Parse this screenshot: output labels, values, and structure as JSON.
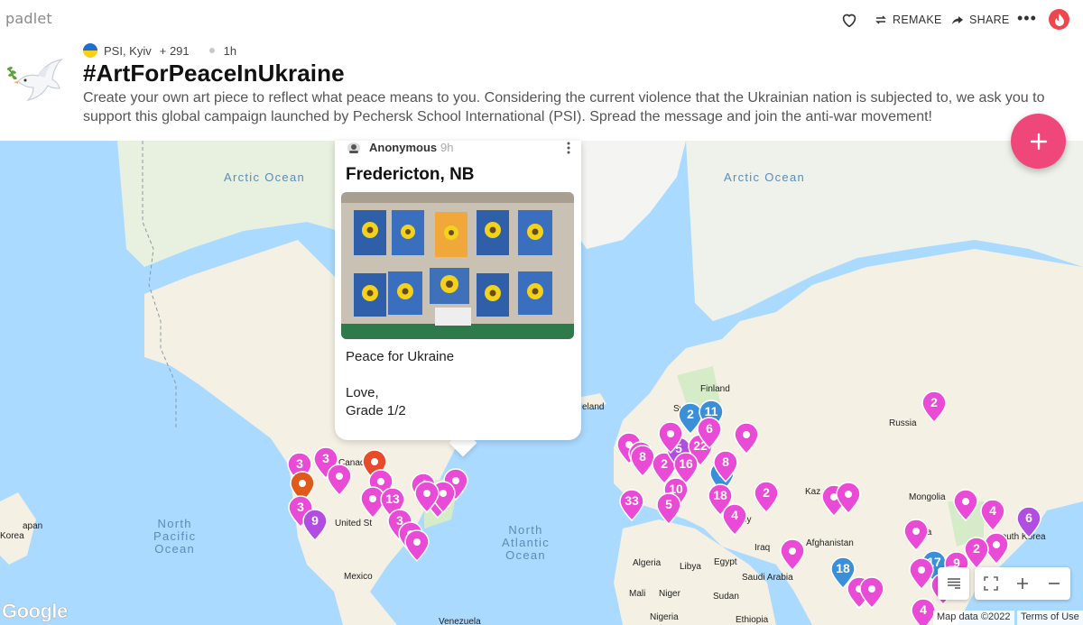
{
  "app": {
    "logo": "padlet"
  },
  "toolbar": {
    "remake_label": "REMAKE",
    "share_label": "SHARE",
    "more_label": "•••"
  },
  "header": {
    "author": "PSI, Kyiv",
    "plus_count": "+ 291",
    "age": "1h",
    "title": "#ArtForPeaceInUkraine",
    "description": "Create your own art piece to reflect what peace means to you. Considering the current violence that the Ukrainian nation is subjected to, we ask you to support this global campaign launched by Pechersk School International (PSI). Spread the message and join the anti-war movement!"
  },
  "post": {
    "author": "Anonymous",
    "time": "9h",
    "title": "Fredericton, NB",
    "body": "Peace for Ukraine\n\nLove,\nGrade 1/2"
  },
  "map": {
    "oceans": [
      {
        "id": "arctic-west",
        "text": "Arctic Ocean"
      },
      {
        "id": "arctic-east",
        "text": "Arctic Ocean"
      },
      {
        "id": "north-pacific",
        "text": "North\nPacific\nOcean"
      },
      {
        "id": "north-atlantic",
        "text": "North\nAtlantic\nOcean"
      }
    ],
    "places": [
      "Finland",
      "Sw",
      "eland",
      "Russia",
      "Canad",
      "United St",
      "Mexico",
      "Kaz",
      "Mongolia",
      "Afghanistan",
      "Iraq",
      "Saudi Arabia",
      "Egypt",
      "Libya",
      "Algeria",
      "Mali",
      "Niger",
      "Nigeria",
      "Sudan",
      "Ethiopia",
      "Venezuela",
      "South Korea",
      "ina",
      "apan",
      "Korea",
      "T",
      "ey"
    ],
    "pins": [
      {
        "label": "3",
        "color": "#e94bd6"
      },
      {
        "label": "3",
        "color": "#e94bd6"
      },
      {
        "label": "",
        "color": "#e94bd6"
      },
      {
        "label": "",
        "color": "#e84a2a"
      },
      {
        "label": "",
        "color": "#e05a1a"
      },
      {
        "label": "3",
        "color": "#e94bd6"
      },
      {
        "label": "9",
        "color": "#b14de0"
      },
      {
        "label": "",
        "color": "#e94bd6"
      },
      {
        "label": "",
        "color": "#e94bd6"
      },
      {
        "label": "13",
        "color": "#e94bd6"
      },
      {
        "label": "4",
        "color": "#e94bd6"
      },
      {
        "label": "5",
        "color": "#e94bd6"
      },
      {
        "label": "3",
        "color": "#e94bd6"
      },
      {
        "label": "",
        "color": "#e94bd6"
      },
      {
        "label": "",
        "color": "#e94bd6"
      },
      {
        "label": "",
        "color": "#e94bd6"
      },
      {
        "label": "",
        "color": "#e94bd6"
      },
      {
        "label": "",
        "color": "#e94bd6"
      },
      {
        "label": "",
        "color": "#e94bd6"
      },
      {
        "label": "",
        "color": "#e94bd6"
      },
      {
        "label": "33",
        "color": "#e94bd6"
      },
      {
        "label": "8",
        "color": "#e94bd6"
      },
      {
        "label": "2",
        "color": "#e94bd6"
      },
      {
        "label": "5",
        "color": "#b14de0"
      },
      {
        "label": "22",
        "color": "#e94bd6"
      },
      {
        "label": "16",
        "color": "#e94bd6"
      },
      {
        "label": "2",
        "color": "#3a8fd8"
      },
      {
        "label": "11",
        "color": "#3a8fd8"
      },
      {
        "label": "6",
        "color": "#e94bd6"
      },
      {
        "label": "",
        "color": "#e94bd6"
      },
      {
        "label": "3",
        "color": "#3a8fd8"
      },
      {
        "label": "8",
        "color": "#e94bd6"
      },
      {
        "label": "10",
        "color": "#e94bd6"
      },
      {
        "label": "18",
        "color": "#e94bd6"
      },
      {
        "label": "5",
        "color": "#e94bd6"
      },
      {
        "label": "4",
        "color": "#e94bd6"
      },
      {
        "label": "2",
        "color": "#e94bd6"
      },
      {
        "label": "",
        "color": "#e94bd6"
      },
      {
        "label": "2",
        "color": "#e94bd6"
      },
      {
        "label": "",
        "color": "#e94bd6"
      },
      {
        "label": "",
        "color": "#e94bd6"
      },
      {
        "label": "",
        "color": "#e94bd6"
      },
      {
        "label": "4",
        "color": "#e94bd6"
      },
      {
        "label": "6",
        "color": "#b14de0"
      },
      {
        "label": "",
        "color": "#e94bd6"
      },
      {
        "label": "",
        "color": "#e94bd6"
      },
      {
        "label": "17",
        "color": "#3a8fd8"
      },
      {
        "label": "9",
        "color": "#e94bd6"
      },
      {
        "label": "2",
        "color": "#e94bd6"
      },
      {
        "label": "",
        "color": "#e94bd6"
      },
      {
        "label": "18",
        "color": "#3a8fd8"
      },
      {
        "label": "",
        "color": "#e94bd6"
      },
      {
        "label": "",
        "color": "#e94bd6"
      },
      {
        "label": "",
        "color": "#e94bd6"
      },
      {
        "label": "4",
        "color": "#e94bd6"
      },
      {
        "label": "",
        "color": "#e94bd6"
      },
      {
        "label": "",
        "color": "#e94bd6"
      }
    ]
  },
  "footer": {
    "google": "Google",
    "map_data": "Map data ©2022",
    "terms": "Terms of Use"
  },
  "colors": {
    "accent": "#f0477a",
    "avatar": "#f0454b",
    "pin_pink": "#e94bd6",
    "pin_blue": "#3a8fd8",
    "pin_purple": "#b14de0",
    "ocean": "#aadaff"
  }
}
